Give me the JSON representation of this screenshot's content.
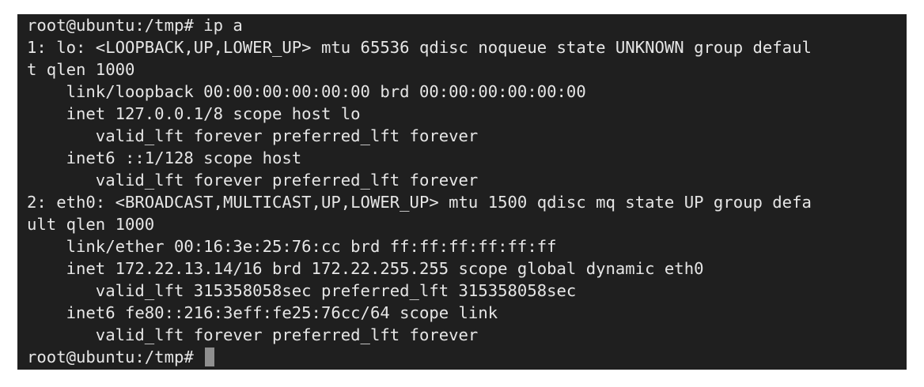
{
  "terminal": {
    "lines": [
      "root@ubuntu:/tmp# ip a",
      "1: lo: <LOOPBACK,UP,LOWER_UP> mtu 65536 qdisc noqueue state UNKNOWN group defaul",
      "t qlen 1000",
      "    link/loopback 00:00:00:00:00:00 brd 00:00:00:00:00:00",
      "    inet 127.0.0.1/8 scope host lo",
      "       valid_lft forever preferred_lft forever",
      "    inet6 ::1/128 scope host",
      "       valid_lft forever preferred_lft forever",
      "2: eth0: <BROADCAST,MULTICAST,UP,LOWER_UP> mtu 1500 qdisc mq state UP group defa",
      "ult qlen 1000",
      "    link/ether 00:16:3e:25:76:cc brd ff:ff:ff:ff:ff:ff",
      "    inet 172.22.13.14/16 brd 172.22.255.255 scope global dynamic eth0",
      "       valid_lft 315358058sec preferred_lft 315358058sec",
      "    inet6 fe80::216:3eff:fe25:76cc/64 scope link",
      "       valid_lft forever preferred_lft forever"
    ],
    "prompt": "root@ubuntu:/tmp# "
  },
  "colors": {
    "background": "#1f1f1f",
    "text": "#e6e6e6",
    "cursor": "#8f8f8f"
  }
}
